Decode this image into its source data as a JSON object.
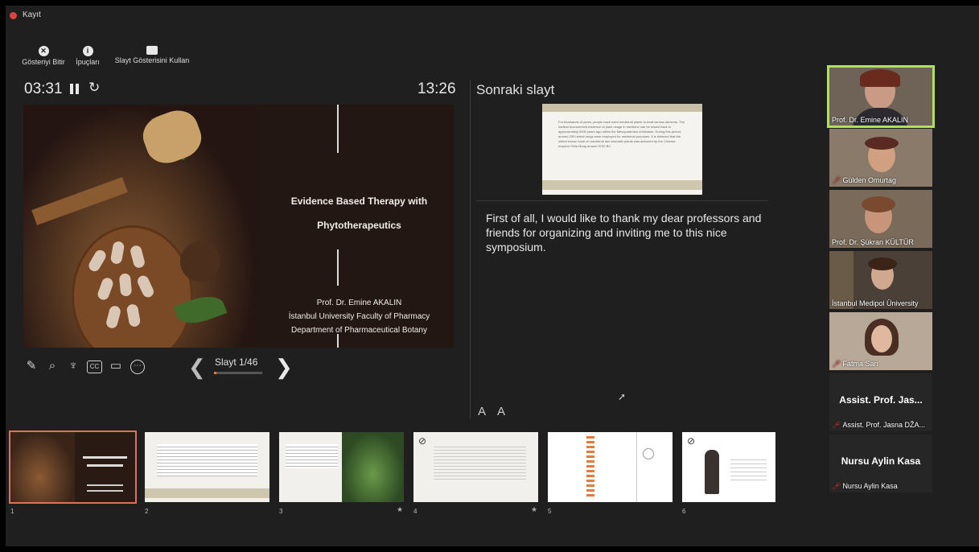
{
  "recording": {
    "label": "Kayıt",
    "dot_color": "#e04040"
  },
  "toolbar": {
    "end_show": "Gösteriyi Bitir",
    "tips": "İpuçları",
    "use_slideshow": "Slayt Gösterisini Kullan"
  },
  "timer": {
    "elapsed": "03:31",
    "clock": "13:26",
    "pause_icon": "pause-icon",
    "reset_icon": "reset-icon"
  },
  "current_slide": {
    "title_line1": "Evidence Based Therapy with",
    "title_line2": "Phytotherapeutics",
    "author": "Prof. Dr. Emine AKALIN",
    "affiliation1": "İstanbul University Faculty of Pharmacy",
    "affiliation2": "Department of Pharmaceutical Botany"
  },
  "slide_nav": {
    "counter": "Slayt 1/46",
    "progress": 0.02,
    "accent": "#e67a3a"
  },
  "next_slide": {
    "label": "Sonraki slayt",
    "text": "For thousands of years, people have used medicinal plants to treat various ailments. The earliest documented evidence of plant usage in medicine can be traced back to approximately 5000 years ago within the Mesopotamian civilization. During this period, around 250 herbal drugs were employed for medicinal purposes. It is believed that the oldest known book on medicinal and aromatic plants was authored by the Chinese emperor Shin-Nong around 3700 BC."
  },
  "notes": "First of all, I would like to thank my dear professors and friends for organizing and inviting me to this nice symposium.",
  "font_controls": {
    "increase": "A",
    "decrease": "A"
  },
  "filmstrip": [
    {
      "num": "1"
    },
    {
      "num": "2"
    },
    {
      "num": "3",
      "star": "★"
    },
    {
      "num": "4",
      "star": "★"
    },
    {
      "num": "5"
    },
    {
      "num": "6"
    }
  ],
  "participants": [
    {
      "name": "Prof. Dr. Emine AKALIN",
      "muted": false,
      "active": true
    },
    {
      "name": "Gülden Omurtag",
      "muted": true
    },
    {
      "name": "Prof. Dr. Şükran KÜLTÜR",
      "muted": false
    },
    {
      "name": "İstanbul Medipol Üniversity",
      "muted": false
    },
    {
      "name": "Fatma Sarı",
      "muted": true
    },
    {
      "name": "Assist. Prof. Jasna DŽA...",
      "big": "Assist. Prof. Jas...",
      "muted": true
    },
    {
      "name": "Nursu Aylin Kasa",
      "big": "Nursu Aylin Kasa",
      "muted": true
    }
  ],
  "active_speaker_color": "#b3e05a"
}
